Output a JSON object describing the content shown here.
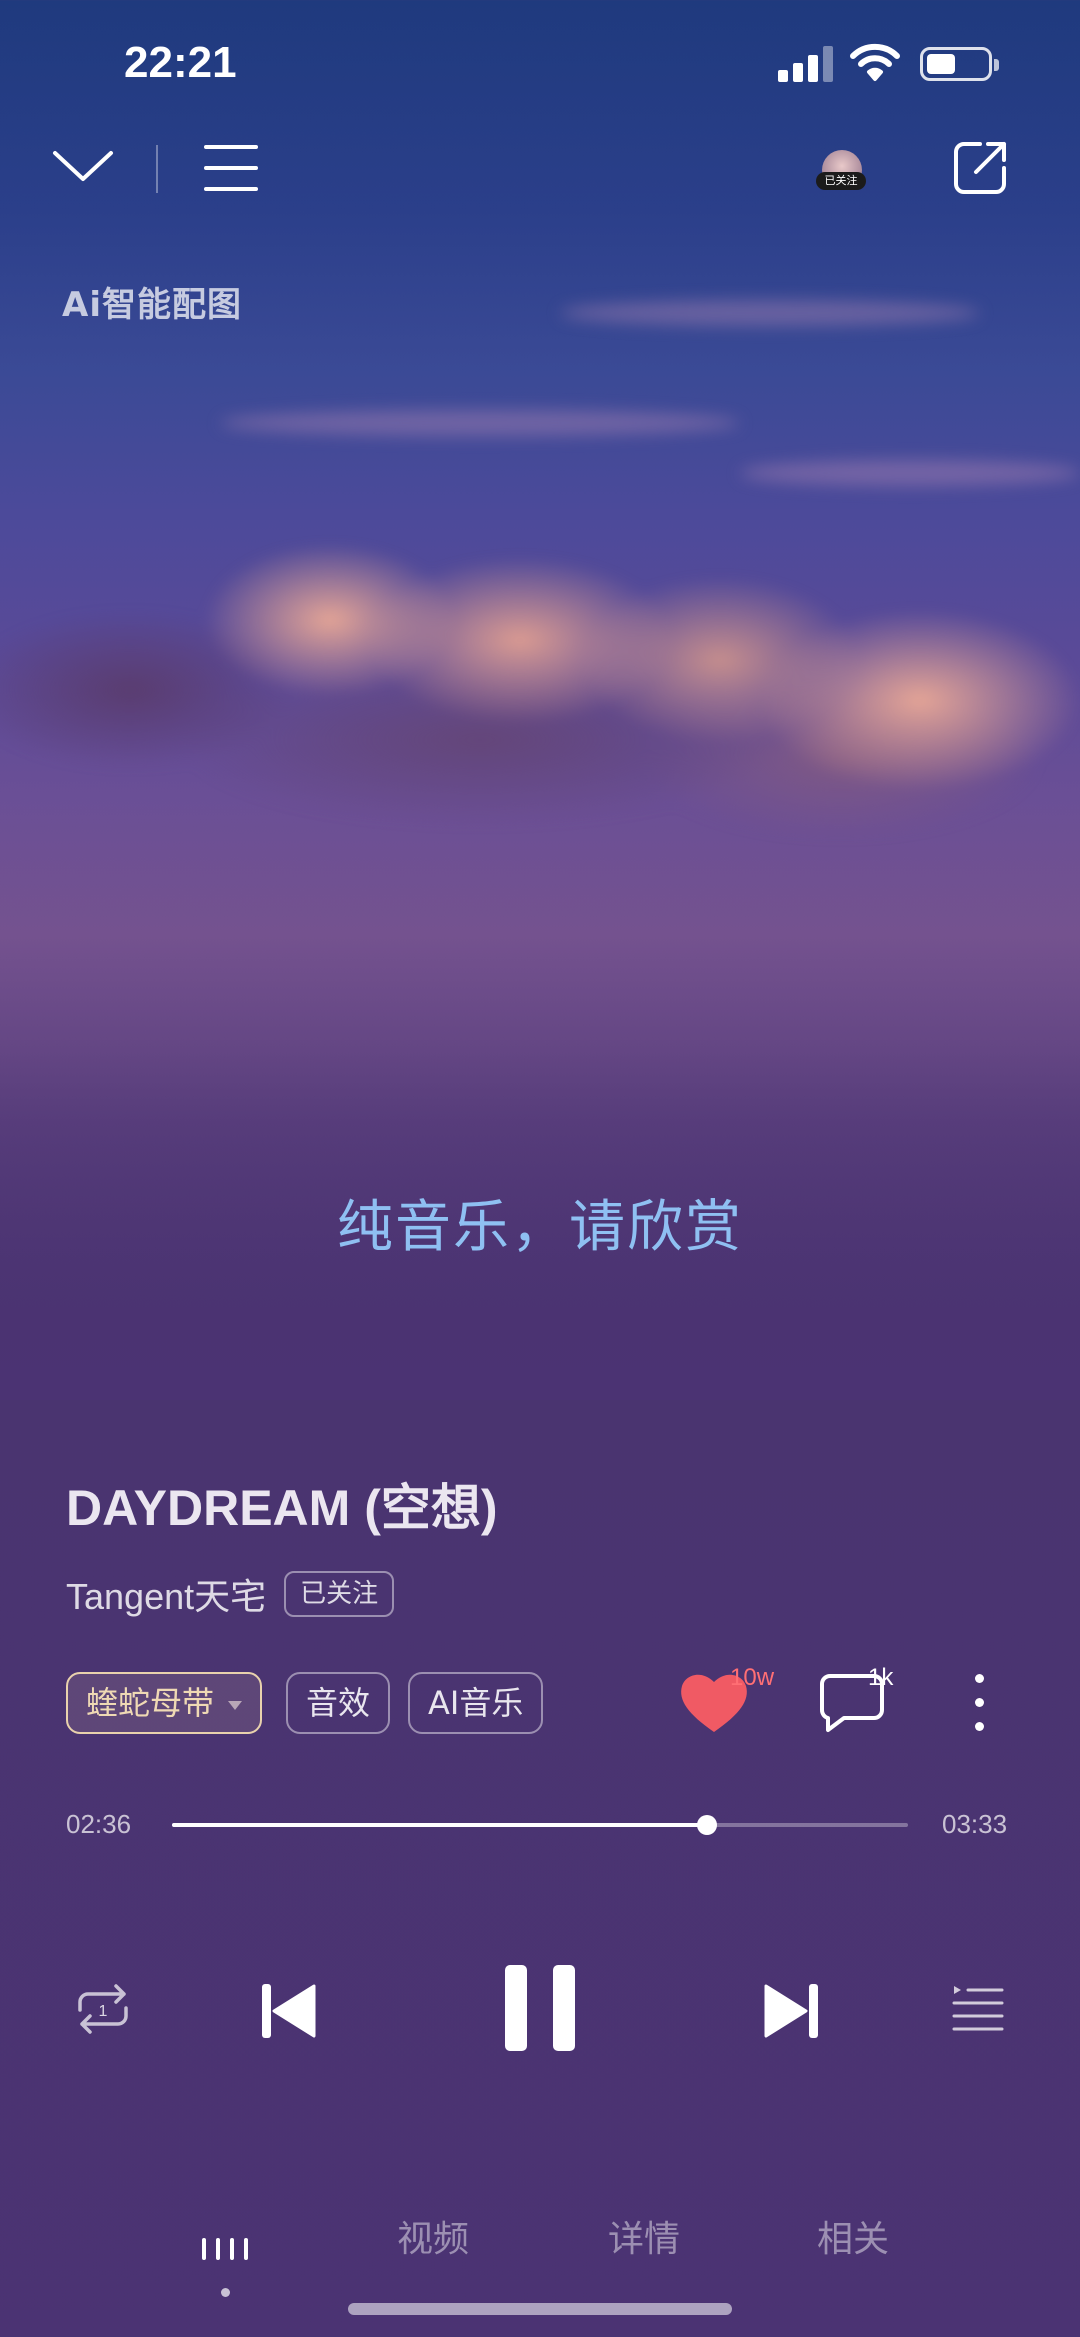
{
  "status_bar": {
    "time": "22:21"
  },
  "top_nav": {
    "artist_follow_tag": "已关注"
  },
  "ai_badge": "Ai智能配图",
  "lyric": "纯音乐，请欣赏",
  "song": {
    "title": "DAYDREAM (空想)",
    "artist": "Tangent天宅",
    "follow_status": "已关注"
  },
  "chips": {
    "sound_type": "蝰蛇母带",
    "effects": "音效",
    "ai_music": "AI音乐"
  },
  "stats": {
    "likes": "10w",
    "comments": "1k"
  },
  "progress": {
    "current": "02:36",
    "total": "03:33",
    "fraction": 0.727
  },
  "repeat_mode_number": "1",
  "tabs": {
    "video": "视频",
    "details": "详情",
    "related": "相关"
  },
  "colors": {
    "lyric": "#8fc0f2",
    "like_heart": "#f05a64",
    "sound_chip": "#e9d2ad"
  }
}
